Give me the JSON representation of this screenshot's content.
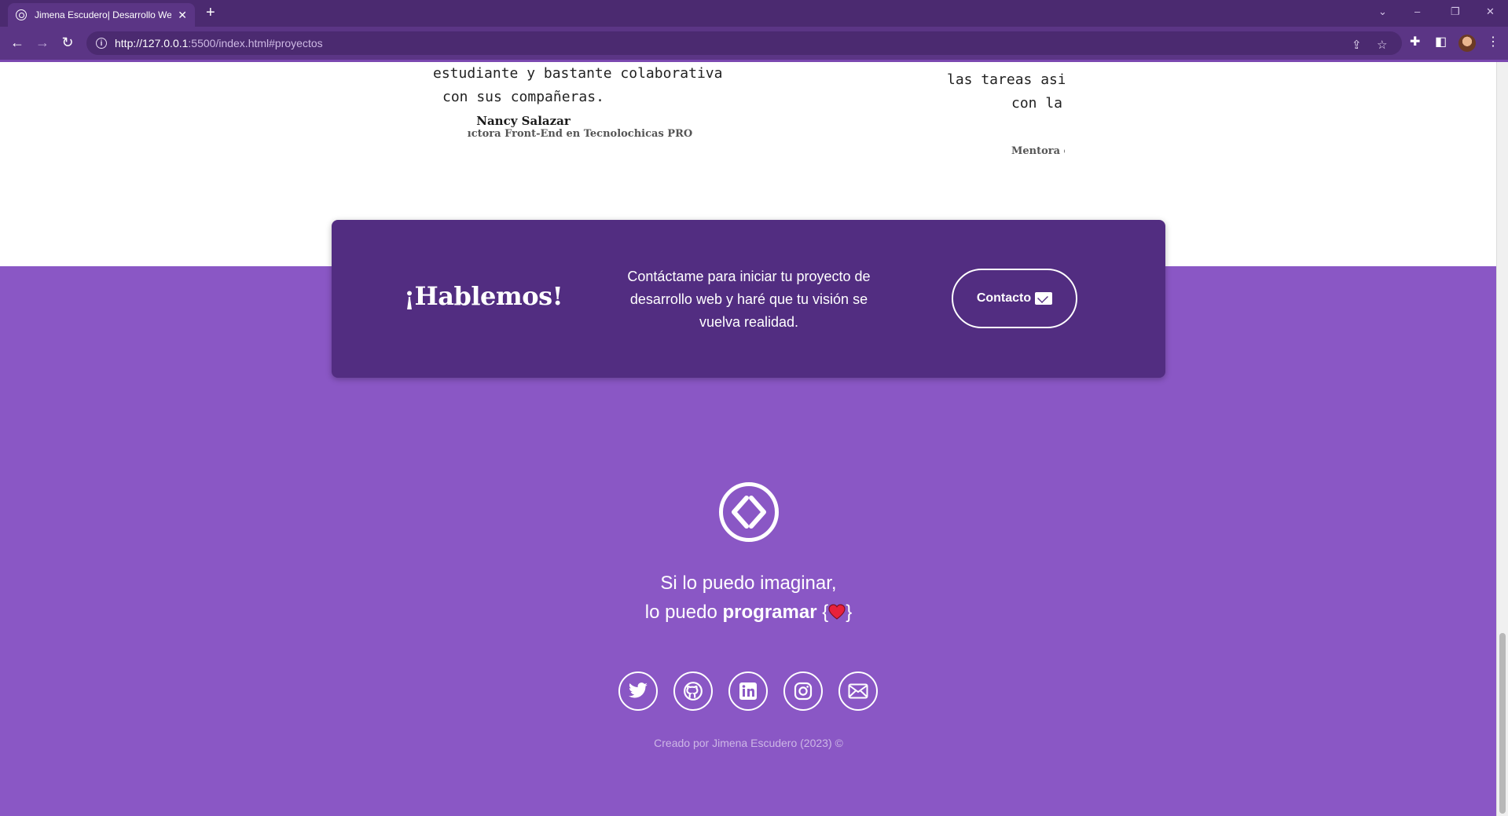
{
  "browser": {
    "tab_title": "Jimena Escudero| Desarrollo Web",
    "tab_close": "✕",
    "new_tab": "+",
    "url_host": "http://127.0.0.1",
    "url_rest": ":5500/index.html#proyectos",
    "window_controls": [
      "⌄",
      "–",
      "❐",
      "✕"
    ]
  },
  "testimonials": [
    {
      "quote_lines": [
        "estudiante y bastante colaborativa",
        "con sus compañeras."
      ],
      "author": "Nancy Salazar",
      "role": "ıctora Front-End en Tecnolochicas PRO"
    },
    {
      "quote_lines": [
        "las tareas asi",
        "con la"
      ],
      "role": "Mentora c"
    }
  ],
  "cta": {
    "title": "¡Hablemos!",
    "text": "Contáctame para iniciar tu proyecto de desarrollo web y haré que tu visión se vuelva realidad.",
    "button_label": "Contacto"
  },
  "footer": {
    "motto_line1": "Si lo puedo imaginar,",
    "motto_line2_prefix": "lo puedo",
    "motto_line2_bold": "programar",
    "brace_open": "{",
    "brace_close": "}",
    "socials": [
      "twitter-icon",
      "github-icon",
      "linkedin-icon",
      "instagram-icon",
      "mail-icon"
    ],
    "copyright": "Creado por Jimena Escudero (2023) ©"
  },
  "colors": {
    "chrome_dark": "#4b2a70",
    "chrome": "#5b3585",
    "footer_bg": "#8a57c5",
    "card_bg": "#522d81"
  }
}
